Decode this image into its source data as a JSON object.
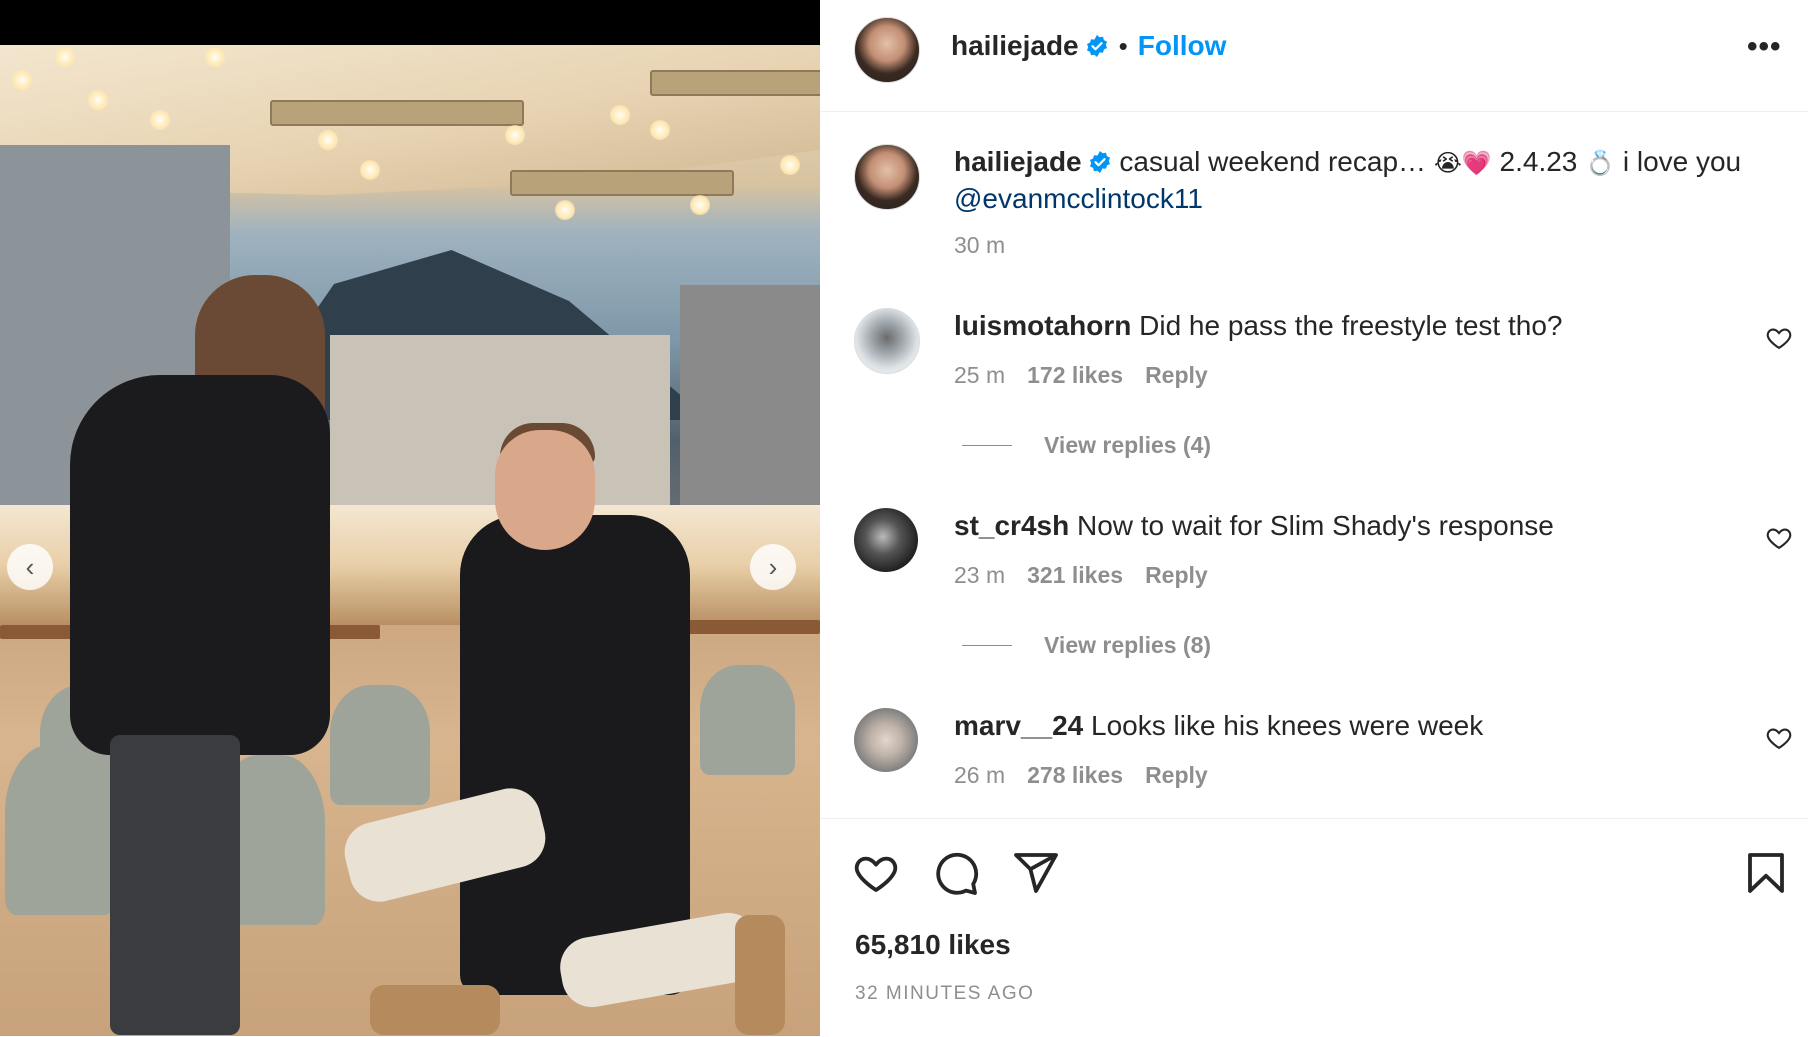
{
  "post": {
    "owner": "hailiejade",
    "follow_label": "Follow",
    "separator": "•",
    "more_label": "•••"
  },
  "caption": {
    "username": "hailiejade",
    "text_a": "casual weekend recap…",
    "emoji_a": "😭💗",
    "text_b": "2.4.23",
    "emoji_b": "💍",
    "text_c": "i love you",
    "mention": "@evanmcclintock11",
    "time": "30 m"
  },
  "comments": [
    {
      "username": "luismotahorn",
      "text": "Did he pass the freestyle test tho?",
      "time": "25 m",
      "likes": "172 likes",
      "reply": "Reply",
      "view_replies": "View replies (4)"
    },
    {
      "username": "st_cr4sh",
      "text": "Now to wait for Slim Shady's response",
      "time": "23 m",
      "likes": "321 likes",
      "reply": "Reply",
      "view_replies": "View replies (8)"
    },
    {
      "username": "marv__24",
      "text": "Looks like his knees were week",
      "time": "26 m",
      "likes": "278 likes",
      "reply": "Reply"
    }
  ],
  "footer": {
    "likes": "65,810 likes",
    "posted_ago": "32 MINUTES AGO"
  },
  "icons": {
    "verified": "verified-badge-icon",
    "like": "heart-icon",
    "comment": "comment-bubble-icon",
    "share": "paper-plane-icon",
    "save": "bookmark-icon",
    "prev": "chevron-left-icon",
    "next": "chevron-right-icon"
  },
  "colors": {
    "accent": "#0095f6",
    "mention": "#00376b",
    "muted": "#8e8e8e",
    "text": "#262626"
  }
}
